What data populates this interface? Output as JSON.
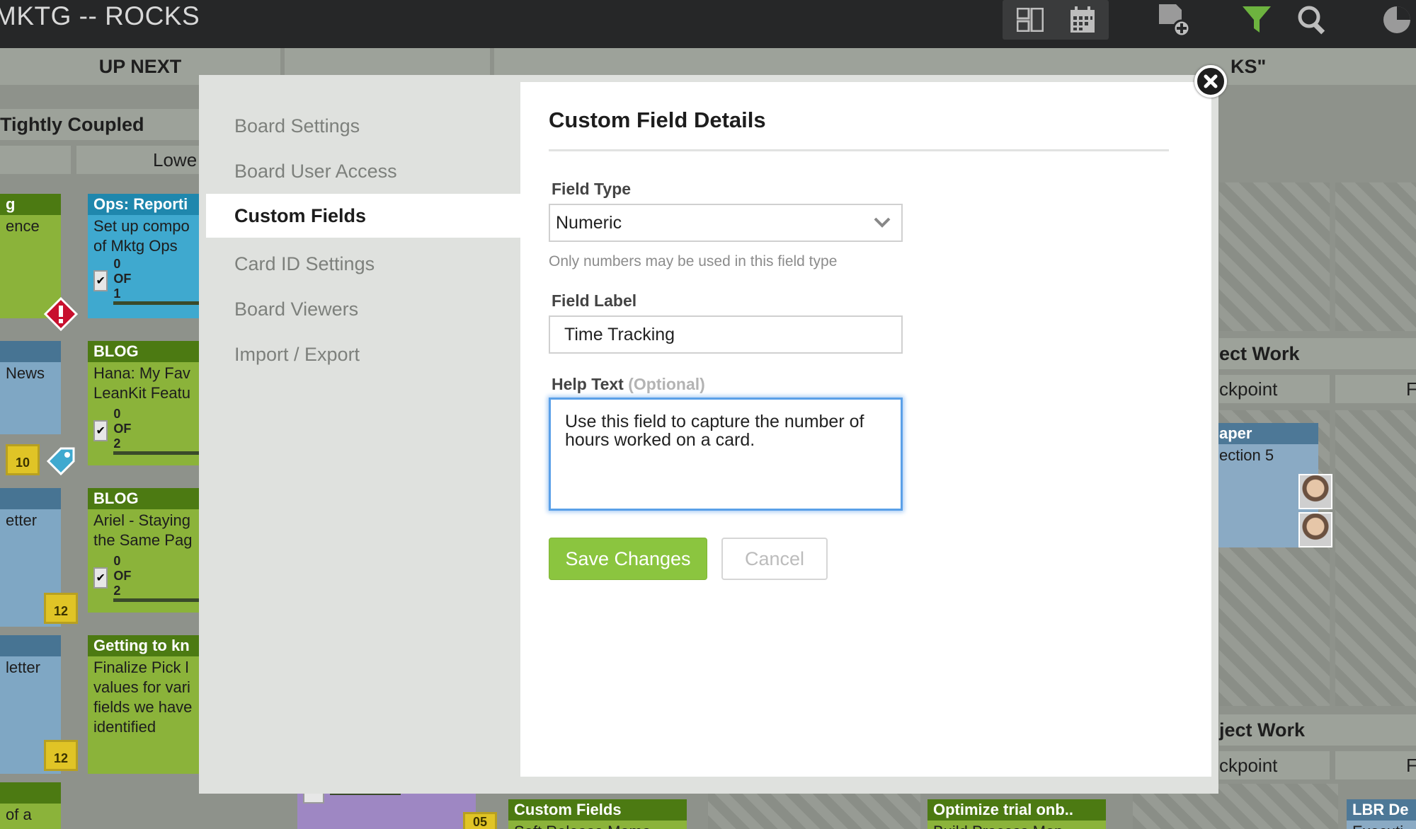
{
  "topbar": {
    "board_title": "MKTG -- ROCKS",
    "icons": [
      "board-layout-icon",
      "calendar-icon",
      "add-card-icon",
      "filter-icon",
      "search-icon",
      "account-icon"
    ]
  },
  "board": {
    "lane_up_next": "UP NEXT",
    "lane_right_partial": "KS\"",
    "sublane_tightly_coupled": "Tightly Coupled",
    "col_lower_partial": "Lowe",
    "sublane_project_work_1": "ect Work",
    "col_checkpoint_1": "ckpoint",
    "col_f_1": "F",
    "sublane_project_work_2": "ject Work",
    "col_checkpoint_2": "ckpoint",
    "col_f_2": "F",
    "cards": {
      "c1_head": "g",
      "c1_body": "ence",
      "c2_head": "Ops: Reporti",
      "c2_body": "Set up compo of Mktg Ops",
      "c2_progress": "0 OF 1",
      "c3_body": "News",
      "c3_date": "10",
      "c4_head": "BLOG",
      "c4_body": "Hana: My Fav LeanKit Featu",
      "c4_progress": "0 OF 2",
      "c5_body": "etter",
      "c5_date": "12",
      "c6_head": "BLOG",
      "c6_body": "Ariel - Staying the Same Pag",
      "c6_progress": "0 OF 2",
      "c7_body": "letter",
      "c7_date": "12",
      "c8_head": "Getting to kn",
      "c8_body": "Finalize Pick l values for vari fields we have identified",
      "c9_body": "of a",
      "c10_head": "aper",
      "c10_body": "ection 5",
      "c11_head": "Custom Fields",
      "c11_body": "Soft Release Memo",
      "c12_head": "Optimize trial onb..",
      "c12_body": "Build Process Map",
      "c13_head": "LBR De",
      "c13_body": "Executi",
      "c14_date": "05"
    }
  },
  "modal": {
    "nav": [
      {
        "label": "Board Settings"
      },
      {
        "label": "Board User Access"
      },
      {
        "label": "Custom Fields",
        "active": true
      },
      {
        "label": "Card ID Settings"
      },
      {
        "label": "Board Viewers"
      },
      {
        "label": "Import / Export"
      }
    ],
    "panel": {
      "title": "Custom Field Details",
      "field_type_label": "Field Type",
      "field_type_value": "Numeric",
      "field_type_hint": "Only numbers may be used in this field type",
      "field_label_label": "Field Label",
      "field_label_value": "Time Tracking",
      "help_text_label": "Help Text",
      "help_text_optional": "(Optional)",
      "help_text_value": "Use this field to capture the number of hours worked on a card.",
      "save_label": "Save Changes",
      "cancel_label": "Cancel"
    }
  },
  "colors": {
    "topbar": "#262728",
    "modal_bg": "#dfe1de",
    "save_green": "#8bc53f",
    "focus_blue": "#5aa0e8",
    "filter_green": "#6db33f"
  }
}
